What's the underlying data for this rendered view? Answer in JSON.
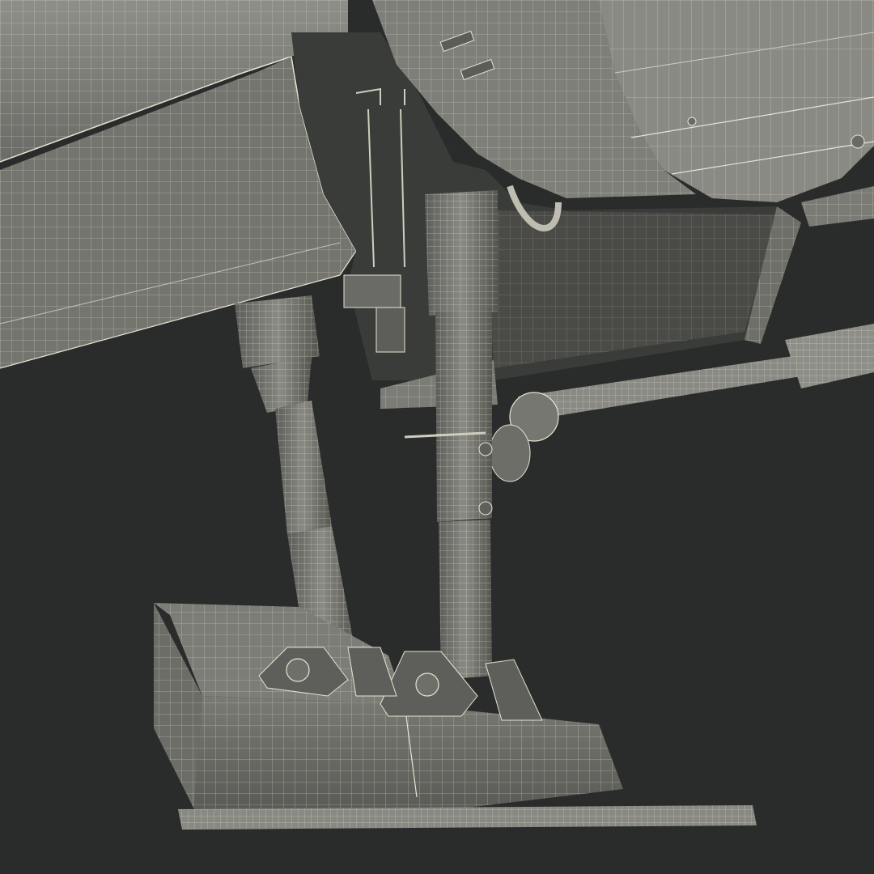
{
  "scene": {
    "subject": "landing-gear-skid",
    "render_style": "wireframe-over-shaded",
    "colors": {
      "background": "#2a2c2c",
      "surface_light": "#8a8a84",
      "surface_mid": "#6e6e69",
      "surface_dark": "#4a4b48",
      "cavity": "#3a3c3a",
      "wire": "#e6e4d2"
    }
  }
}
